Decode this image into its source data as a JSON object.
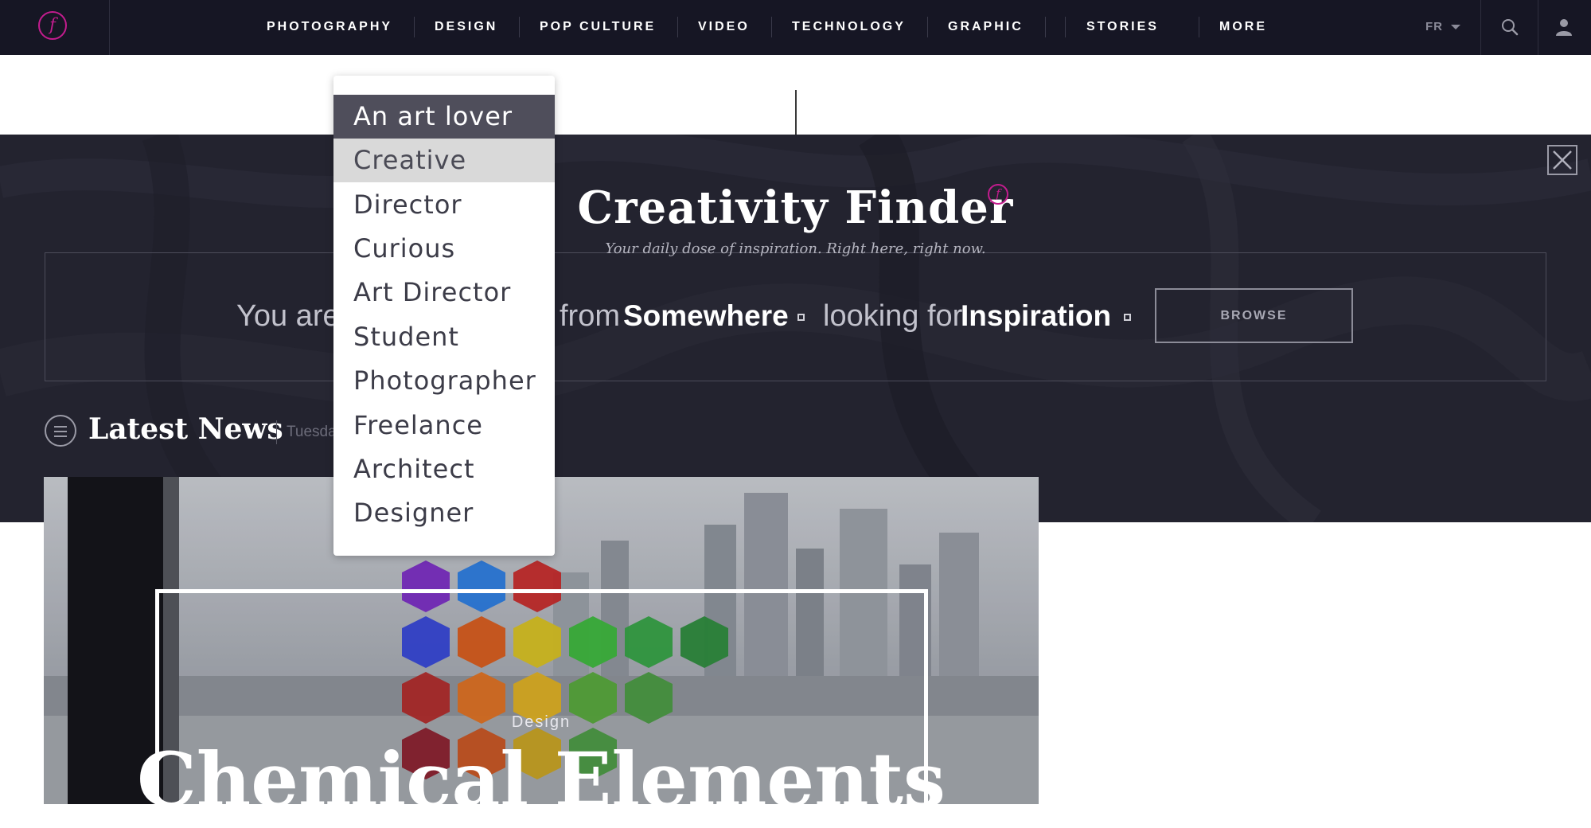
{
  "nav": {
    "items": [
      "PHOTOGRAPHY",
      "DESIGN",
      "POP CULTURE",
      "VIDEO",
      "TECHNOLOGY",
      "GRAPHIC",
      "STORIES",
      "MORE"
    ],
    "lang": "FR",
    "icons": [
      "search-icon",
      "user-icon"
    ],
    "brand_color": "#c31c8e"
  },
  "hero": {
    "title": "Creativity Finder",
    "subtitle": "Your daily dose of inspiration. Right here, right now.",
    "sentence": {
      "prefix": "You are",
      "from": "from",
      "location": "Somewhere",
      "looking": "looking for",
      "topic": "Inspiration"
    },
    "browse_label": "BROWSE"
  },
  "news": {
    "title": "Latest News",
    "date": "Tuesda"
  },
  "feature": {
    "category": "Design",
    "title": "Chemical Elements"
  },
  "dropdown": {
    "selected": "An art lover",
    "options": [
      "An art lover",
      "Creative",
      "Director",
      "Curious",
      "Art Director",
      "Student",
      "Photographer",
      "Freelance",
      "Architect",
      "Designer"
    ]
  }
}
